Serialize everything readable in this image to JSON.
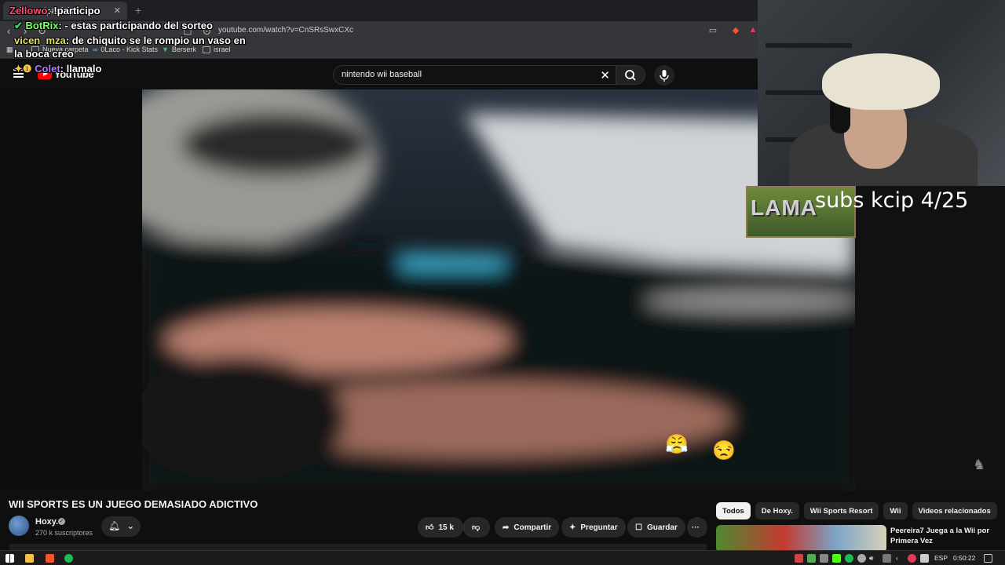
{
  "browser": {
    "tab_title": "Zellowo: !participo",
    "new_tab": "+",
    "url": "youtube.com/watch?v=CnSRsSwxCXc",
    "bookmarks": [
      "Nueva carpeta",
      "0Laco - Kick Stats",
      "Berserk",
      "israel"
    ]
  },
  "chat": [
    {
      "user": "Zellowo",
      "message": "!participo"
    },
    {
      "user": "BotRix",
      "message": "- estas participando del sorteo"
    },
    {
      "user": "vicen_mza",
      "message": "de chiquito se le rompio un vaso en"
    },
    {
      "user": "",
      "message": "la boca creo"
    },
    {
      "user": "Colet",
      "message": "llamalo"
    }
  ],
  "youtube": {
    "logo_text": "YouTube",
    "search_query": "nintendo wii baseball",
    "video_title": "WII SPORTS ES UN JUEGO DEMASIADO ADICTIVO",
    "channel_name": "Hoxy.",
    "subscribers": "270 k suscriptores",
    "likes": "15 k",
    "share_label": "Compartir",
    "ask_label": "Preguntar",
    "save_label": "Guardar",
    "more_label": "···",
    "chips": [
      "Todos",
      "De Hoxy.",
      "Wii Sports Resort",
      "Wii",
      "Videos relacionados"
    ],
    "recommended_title": "Peereira7 Juega a la Wii por Primera Vez"
  },
  "overlay": {
    "subs_label": "subs kcip 4/25",
    "subs_logo": "LAMA",
    "emoji_1": "😤",
    "emoji_2": "😒"
  },
  "taskbar": {
    "language": "ESP",
    "time": "0:50:22"
  },
  "colors": {
    "youtube_red": "#ff0000",
    "background": "#0f0f0f",
    "chip_active": "#f1f1f1"
  }
}
